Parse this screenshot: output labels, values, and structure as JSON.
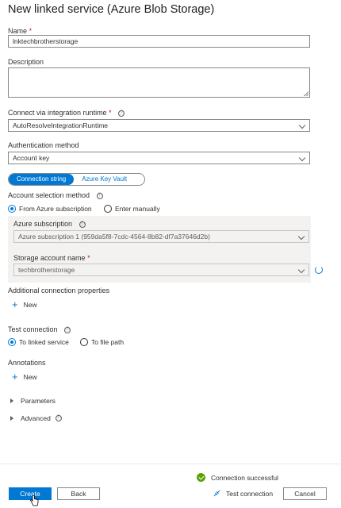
{
  "title": "New linked service (Azure Blob Storage)",
  "name": {
    "label": "Name",
    "required_mark": "*",
    "value": "lnktechbrotherstorage"
  },
  "description": {
    "label": "Description",
    "value": ""
  },
  "integration_runtime": {
    "label": "Connect via integration runtime",
    "required_mark": "*",
    "info_icon": "ⓘ",
    "value": "AutoResolveIntegrationRuntime"
  },
  "auth": {
    "label": "Authentication method",
    "value": "Account key"
  },
  "connection_toggle": {
    "active": "Connection string",
    "inactive": "Azure Key Vault"
  },
  "account_selection": {
    "label": "Account selection method",
    "info_icon": "ⓘ",
    "options": [
      "From Azure subscription",
      "Enter manually"
    ],
    "selected": "From Azure subscription"
  },
  "subscription": {
    "label": "Azure subscription",
    "info_icon": "ⓘ",
    "value": "Azure subscription 1 (959da5f8-7cdc-4564-8b82-df7a37646d2b)"
  },
  "storage_account": {
    "label": "Storage account name",
    "required_mark": "*",
    "value": "techbrotherstorage"
  },
  "additional_props": {
    "label": "Additional connection properties",
    "new_label": "New"
  },
  "test_connection": {
    "label": "Test connection",
    "info_icon": "ⓘ",
    "options": [
      "To linked service",
      "To file path"
    ],
    "selected": "To linked service"
  },
  "annotations": {
    "label": "Annotations",
    "new_label": "New"
  },
  "parameters": {
    "label": "Parameters"
  },
  "advanced": {
    "label": "Advanced",
    "info_icon": "ⓘ"
  },
  "footer": {
    "status": "Connection successful",
    "create": "Create",
    "back": "Back",
    "test_connection": "Test connection",
    "cancel": "Cancel"
  },
  "colors": {
    "accent": "#0078d4",
    "success": "#57a300",
    "required": "#a4262c"
  }
}
